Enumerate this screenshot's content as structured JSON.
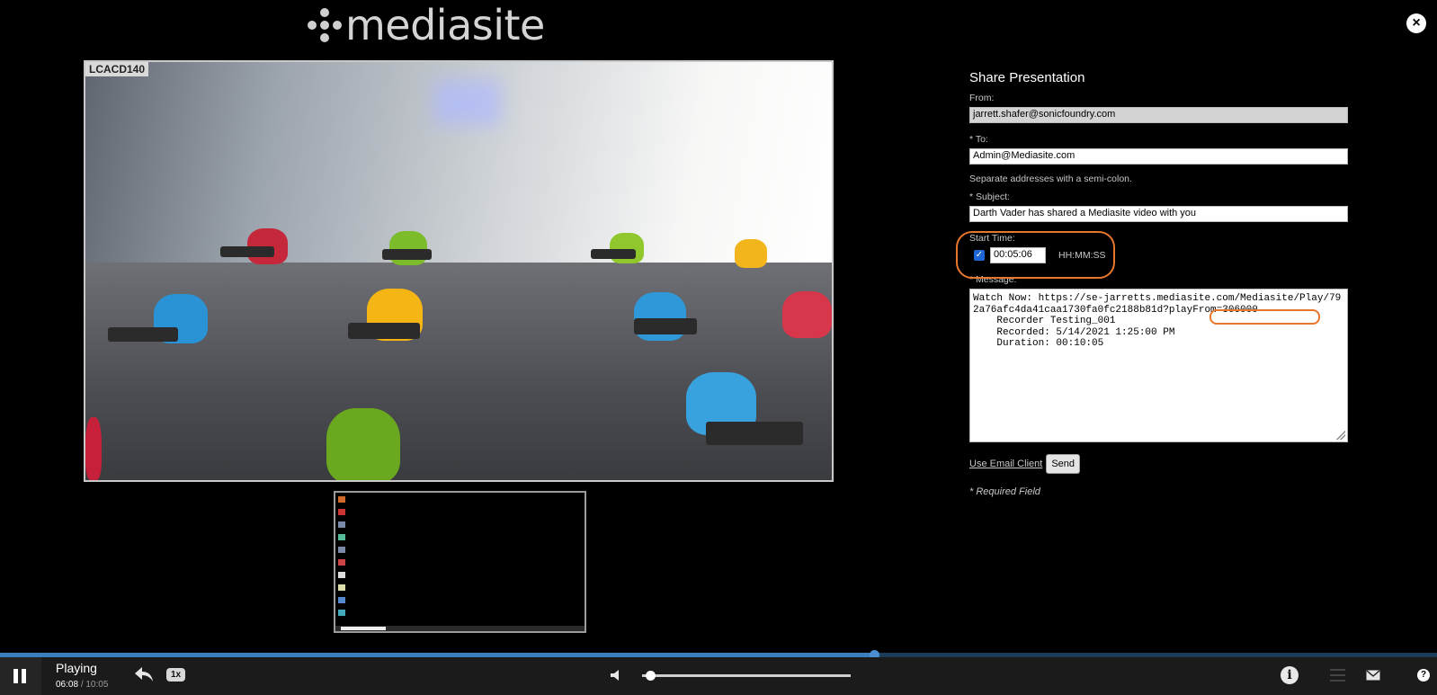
{
  "header": {
    "logo_text": "mediasite",
    "close_glyph": "×"
  },
  "video": {
    "label": "LCACD140"
  },
  "share": {
    "title": "Share Presentation",
    "from_label": "From:",
    "from_value": "jarrett.shafer@sonicfoundry.com",
    "to_label": "* To:",
    "to_value": "Admin@Mediasite.com",
    "to_hint": "Separate addresses with a semi-colon.",
    "subject_label": "* Subject:",
    "subject_value": "Darth Vader has shared a Mediasite video with you",
    "start_time_label": "Start Time:",
    "start_time_checked": true,
    "start_time_value": "00:05:06",
    "start_time_format": "HH:MM:SS",
    "message_label": "* Message:",
    "message_value": "Watch Now: https://se-jarretts.mediasite.com/Mediasite/Play/792a76afc4da41caa1730fa0fc2188b81d?playFrom=306000\n    Recorder Testing_001\n    Recorded: 5/14/2021 1:25:00 PM\n    Duration: 00:10:05",
    "email_client_link": "Use Email Client",
    "send_label": "Send",
    "required_note": "* Required Field"
  },
  "player": {
    "status": "Playing",
    "current_time": "06:08",
    "separator": "/",
    "duration": "10:05",
    "playback_rate": "1x",
    "progress_fraction": 0.608,
    "volume_fraction": 0.02,
    "icons": [
      "pause-icon",
      "reply-icon",
      "volume-icon",
      "info-icon",
      "menu-icon",
      "mail-icon",
      "help-icon"
    ],
    "accent_color": "#3a7fc0",
    "highlight_color": "#e8772e"
  }
}
